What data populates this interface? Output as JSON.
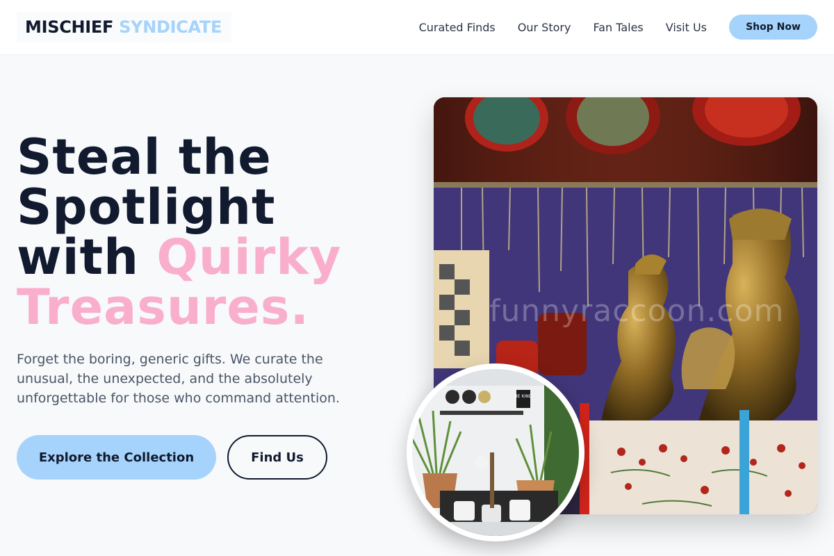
{
  "brand": {
    "name_part1": "MISCHIEF",
    "name_part2": "SYNDICATE"
  },
  "nav": {
    "items": [
      {
        "label": "Curated Finds"
      },
      {
        "label": "Our Story"
      },
      {
        "label": "Fan Tales"
      },
      {
        "label": "Visit Us"
      }
    ],
    "cta_label": "Shop Now"
  },
  "hero": {
    "title_line1": "Steal the",
    "title_line2": "Spotlight",
    "title_line3_plain": "with",
    "title_line3_accent": "Quirky",
    "title_line4_accent": "Treasures.",
    "description": "Forget the boring, generic gifts. We curate the unusual, the unexpected, and the absolutely unforgettable for those who command attention.",
    "primary_button": "Explore the Collection",
    "secondary_button": "Find Us"
  },
  "images": {
    "main_watermark": "funnyraccoon.com",
    "inset_sign": "BE KIND"
  },
  "colors": {
    "accent_blue": "#a6d3fb",
    "accent_pink": "#f9aecb",
    "ink": "#111a2e",
    "muted_text": "#4a5566",
    "background": "#f7f9fb"
  }
}
